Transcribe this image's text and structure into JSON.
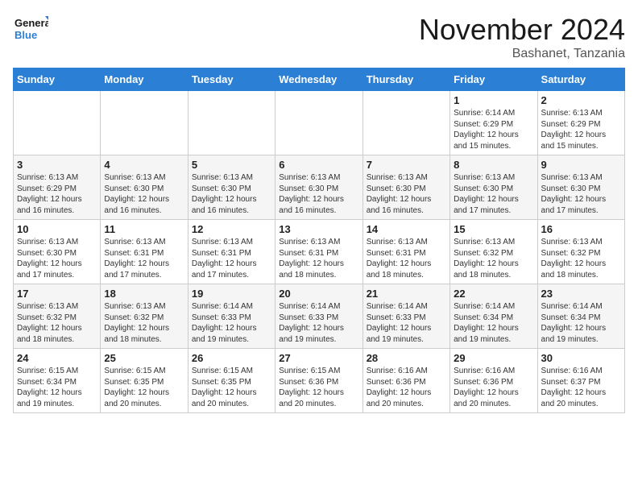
{
  "header": {
    "logo_text_general": "General",
    "logo_text_blue": "Blue",
    "title": "November 2024",
    "subtitle": "Bashanet, Tanzania"
  },
  "days_of_week": [
    "Sunday",
    "Monday",
    "Tuesday",
    "Wednesday",
    "Thursday",
    "Friday",
    "Saturday"
  ],
  "weeks": [
    [
      {
        "day": "",
        "info": ""
      },
      {
        "day": "",
        "info": ""
      },
      {
        "day": "",
        "info": ""
      },
      {
        "day": "",
        "info": ""
      },
      {
        "day": "",
        "info": ""
      },
      {
        "day": "1",
        "info": "Sunrise: 6:14 AM\nSunset: 6:29 PM\nDaylight: 12 hours\nand 15 minutes."
      },
      {
        "day": "2",
        "info": "Sunrise: 6:13 AM\nSunset: 6:29 PM\nDaylight: 12 hours\nand 15 minutes."
      }
    ],
    [
      {
        "day": "3",
        "info": "Sunrise: 6:13 AM\nSunset: 6:29 PM\nDaylight: 12 hours\nand 16 minutes."
      },
      {
        "day": "4",
        "info": "Sunrise: 6:13 AM\nSunset: 6:30 PM\nDaylight: 12 hours\nand 16 minutes."
      },
      {
        "day": "5",
        "info": "Sunrise: 6:13 AM\nSunset: 6:30 PM\nDaylight: 12 hours\nand 16 minutes."
      },
      {
        "day": "6",
        "info": "Sunrise: 6:13 AM\nSunset: 6:30 PM\nDaylight: 12 hours\nand 16 minutes."
      },
      {
        "day": "7",
        "info": "Sunrise: 6:13 AM\nSunset: 6:30 PM\nDaylight: 12 hours\nand 16 minutes."
      },
      {
        "day": "8",
        "info": "Sunrise: 6:13 AM\nSunset: 6:30 PM\nDaylight: 12 hours\nand 17 minutes."
      },
      {
        "day": "9",
        "info": "Sunrise: 6:13 AM\nSunset: 6:30 PM\nDaylight: 12 hours\nand 17 minutes."
      }
    ],
    [
      {
        "day": "10",
        "info": "Sunrise: 6:13 AM\nSunset: 6:30 PM\nDaylight: 12 hours\nand 17 minutes."
      },
      {
        "day": "11",
        "info": "Sunrise: 6:13 AM\nSunset: 6:31 PM\nDaylight: 12 hours\nand 17 minutes."
      },
      {
        "day": "12",
        "info": "Sunrise: 6:13 AM\nSunset: 6:31 PM\nDaylight: 12 hours\nand 17 minutes."
      },
      {
        "day": "13",
        "info": "Sunrise: 6:13 AM\nSunset: 6:31 PM\nDaylight: 12 hours\nand 18 minutes."
      },
      {
        "day": "14",
        "info": "Sunrise: 6:13 AM\nSunset: 6:31 PM\nDaylight: 12 hours\nand 18 minutes."
      },
      {
        "day": "15",
        "info": "Sunrise: 6:13 AM\nSunset: 6:32 PM\nDaylight: 12 hours\nand 18 minutes."
      },
      {
        "day": "16",
        "info": "Sunrise: 6:13 AM\nSunset: 6:32 PM\nDaylight: 12 hours\nand 18 minutes."
      }
    ],
    [
      {
        "day": "17",
        "info": "Sunrise: 6:13 AM\nSunset: 6:32 PM\nDaylight: 12 hours\nand 18 minutes."
      },
      {
        "day": "18",
        "info": "Sunrise: 6:13 AM\nSunset: 6:32 PM\nDaylight: 12 hours\nand 18 minutes."
      },
      {
        "day": "19",
        "info": "Sunrise: 6:14 AM\nSunset: 6:33 PM\nDaylight: 12 hours\nand 19 minutes."
      },
      {
        "day": "20",
        "info": "Sunrise: 6:14 AM\nSunset: 6:33 PM\nDaylight: 12 hours\nand 19 minutes."
      },
      {
        "day": "21",
        "info": "Sunrise: 6:14 AM\nSunset: 6:33 PM\nDaylight: 12 hours\nand 19 minutes."
      },
      {
        "day": "22",
        "info": "Sunrise: 6:14 AM\nSunset: 6:34 PM\nDaylight: 12 hours\nand 19 minutes."
      },
      {
        "day": "23",
        "info": "Sunrise: 6:14 AM\nSunset: 6:34 PM\nDaylight: 12 hours\nand 19 minutes."
      }
    ],
    [
      {
        "day": "24",
        "info": "Sunrise: 6:15 AM\nSunset: 6:34 PM\nDaylight: 12 hours\nand 19 minutes."
      },
      {
        "day": "25",
        "info": "Sunrise: 6:15 AM\nSunset: 6:35 PM\nDaylight: 12 hours\nand 20 minutes."
      },
      {
        "day": "26",
        "info": "Sunrise: 6:15 AM\nSunset: 6:35 PM\nDaylight: 12 hours\nand 20 minutes."
      },
      {
        "day": "27",
        "info": "Sunrise: 6:15 AM\nSunset: 6:36 PM\nDaylight: 12 hours\nand 20 minutes."
      },
      {
        "day": "28",
        "info": "Sunrise: 6:16 AM\nSunset: 6:36 PM\nDaylight: 12 hours\nand 20 minutes."
      },
      {
        "day": "29",
        "info": "Sunrise: 6:16 AM\nSunset: 6:36 PM\nDaylight: 12 hours\nand 20 minutes."
      },
      {
        "day": "30",
        "info": "Sunrise: 6:16 AM\nSunset: 6:37 PM\nDaylight: 12 hours\nand 20 minutes."
      }
    ]
  ]
}
